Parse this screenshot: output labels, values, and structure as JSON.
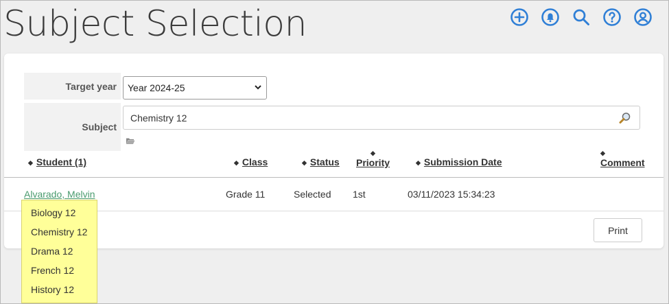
{
  "page": {
    "title": "Subject Selection"
  },
  "header_icons": [
    "add-circle-icon",
    "bell-icon",
    "search-icon",
    "help-icon",
    "account-icon"
  ],
  "colors": {
    "accent": "#2f7fd6",
    "link": "#4a9b6e",
    "tooltip_bg": "#ffff99"
  },
  "form": {
    "target_year_label": "Target year",
    "target_year_value": "Year 2024-25",
    "subject_label": "Subject",
    "subject_value": "Chemistry 12"
  },
  "table": {
    "columns": {
      "student": "Student (1)",
      "class": "Class",
      "status": "Status",
      "priority": "Priority",
      "submission_date": "Submission Date",
      "comment": "Comment"
    },
    "rows": [
      {
        "student": "Alvarado, Melvin",
        "class": "Grade 11",
        "status": "Selected",
        "priority": "1st",
        "submission_date": "03/11/2023 15:34:23",
        "comment": ""
      }
    ]
  },
  "actions": {
    "print_label": "Print"
  },
  "tooltip": {
    "items": [
      "Biology 12",
      "Chemistry 12",
      "Drama 12",
      "French 12",
      "History 12"
    ]
  }
}
